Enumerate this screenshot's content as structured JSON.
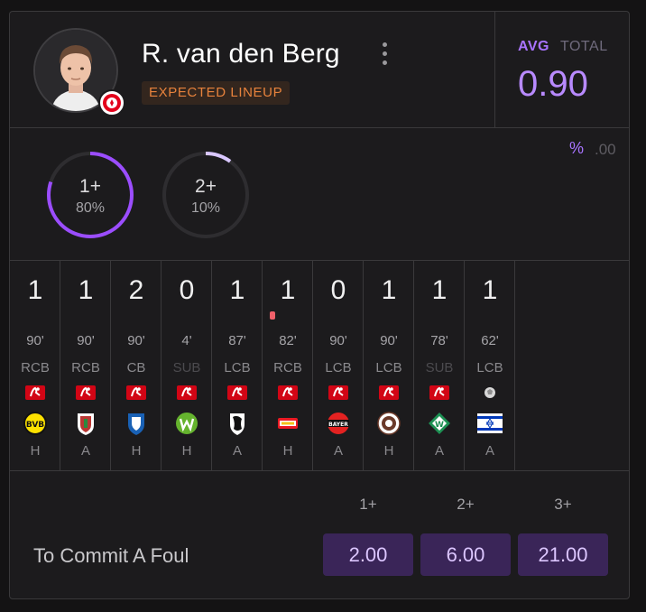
{
  "player": {
    "name": "R. van den Berg",
    "status": "EXPECTED LINEUP",
    "avatar_icon": "player-photo",
    "club_badge_icon": "fc-koln-badge"
  },
  "summary": {
    "avg_label": "AVG",
    "total_label": "TOTAL",
    "value": "0.90",
    "percent_label": "%",
    "percent_value": ".00"
  },
  "probabilities": [
    {
      "label": "1+",
      "value": "80%",
      "fraction": 0.8,
      "color": "#9b4dff"
    },
    {
      "label": "2+",
      "value": "10%",
      "fraction": 0.1,
      "color": "#d9c7ff"
    }
  ],
  "history": [
    {
      "count": "1",
      "minutes": "90'",
      "position": "RCB",
      "competition_icon": "bundesliga-icon",
      "opponent_icon": "dortmund-crest",
      "venue": "H",
      "sub": false
    },
    {
      "count": "1",
      "minutes": "90'",
      "position": "RCB",
      "competition_icon": "bundesliga-icon",
      "opponent_icon": "augsburg-crest",
      "venue": "A",
      "sub": false
    },
    {
      "count": "2",
      "minutes": "90'",
      "position": "CB",
      "competition_icon": "bundesliga-icon",
      "opponent_icon": "hoffenheim-crest",
      "venue": "H",
      "sub": false
    },
    {
      "count": "0",
      "minutes": "4'",
      "position": "SUB",
      "competition_icon": "bundesliga-icon",
      "opponent_icon": "wolfsburg-crest",
      "venue": "H",
      "sub": true
    },
    {
      "count": "1",
      "minutes": "87'",
      "position": "LCB",
      "competition_icon": "bundesliga-icon",
      "opponent_icon": "freiburg-crest",
      "venue": "A",
      "sub": false
    },
    {
      "count": "1",
      "minutes": "82'",
      "position": "RCB",
      "competition_icon": "bundesliga-icon",
      "opponent_icon": "union-berlin-crest",
      "venue": "H",
      "sub": false,
      "marker": true
    },
    {
      "count": "0",
      "minutes": "90'",
      "position": "LCB",
      "competition_icon": "bundesliga-icon",
      "opponent_icon": "leverkusen-crest",
      "venue": "A",
      "sub": false
    },
    {
      "count": "1",
      "minutes": "90'",
      "position": "LCB",
      "competition_icon": "bundesliga-icon",
      "opponent_icon": "st-pauli-crest",
      "venue": "H",
      "sub": false
    },
    {
      "count": "1",
      "minutes": "78'",
      "position": "SUB",
      "competition_icon": "bundesliga-icon",
      "opponent_icon": "werder-bremen-crest",
      "venue": "A",
      "sub": true
    },
    {
      "count": "1",
      "minutes": "62'",
      "position": "LCB",
      "competition_icon": "friendly-icon",
      "opponent_icon": "israel-flag",
      "venue": "A",
      "sub": false
    }
  ],
  "market": {
    "label": "To Commit A Foul",
    "lines": [
      {
        "header": "1+",
        "odds": "2.00"
      },
      {
        "header": "2+",
        "odds": "6.00"
      },
      {
        "header": "3+",
        "odds": "21.00"
      }
    ]
  },
  "colors": {
    "accent": "#a873ff",
    "tag": "#e7823c",
    "odds_bg": "#3a2558"
  }
}
